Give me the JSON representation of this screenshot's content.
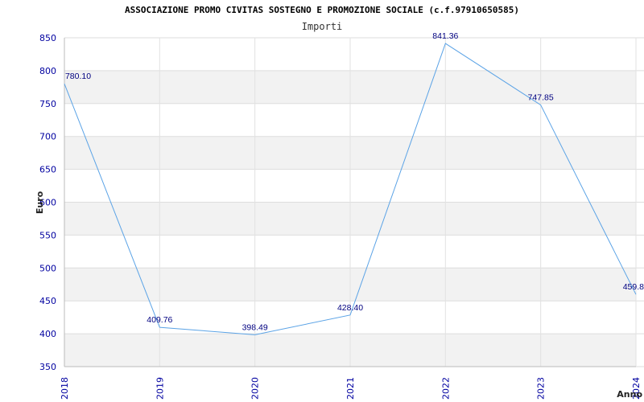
{
  "chart_data": {
    "type": "line",
    "title": "ASSOCIAZIONE PROMO CIVITAS SOSTEGNO E PROMOZIONE SOCIALE (c.f.97910650585)",
    "subtitle": "Importi",
    "xlabel": "Anno",
    "ylabel": "Euro",
    "categories": [
      "2018",
      "2019",
      "2020",
      "2021",
      "2022",
      "2023",
      "2024"
    ],
    "values": [
      780.1,
      409.76,
      398.49,
      428.4,
      841.36,
      747.85,
      459.8
    ],
    "data_labels": [
      "780.10",
      "409.76",
      "398.49",
      "428.40",
      "841.36",
      "747.85",
      "459.8"
    ],
    "y_ticks": [
      "350",
      "400",
      "450",
      "500",
      "550",
      "600",
      "650",
      "700",
      "750",
      "800",
      "850"
    ],
    "ylim": [
      350,
      850
    ],
    "grid": true,
    "line_color": "#5ba3e6",
    "band_color": "#f2f2f2",
    "tick_color": "#0000a0"
  }
}
